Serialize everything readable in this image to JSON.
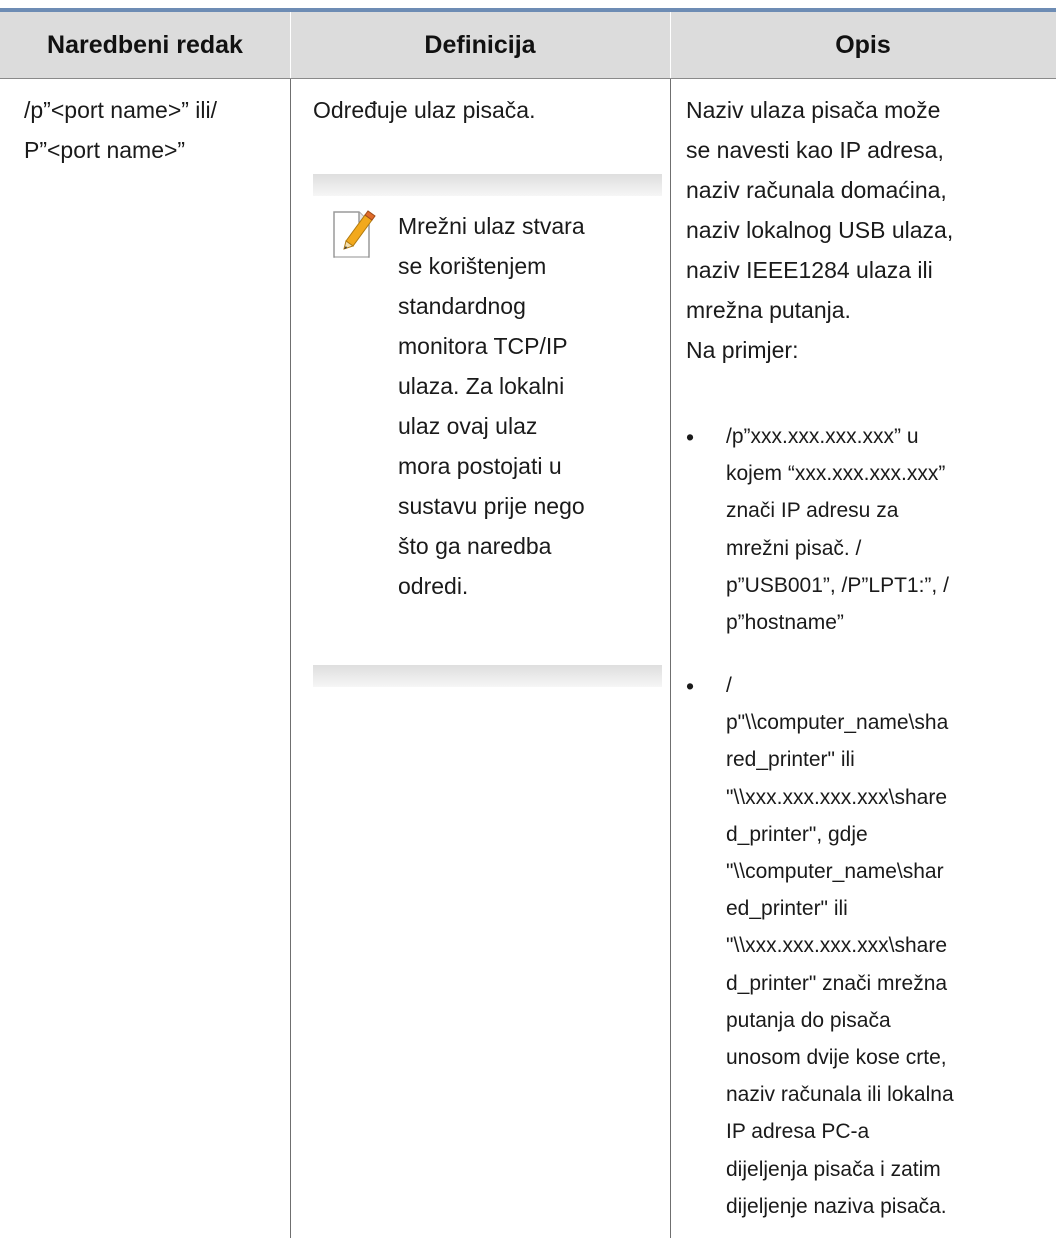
{
  "table": {
    "headers": [
      "Naredbeni redak",
      "Definicija",
      "Opis"
    ],
    "row": {
      "command": "/p”<port name>” ili/\nP”<port name>”",
      "definition": "Određuje ulaz pisača.",
      "note": {
        "icon": "note-pencil-icon",
        "text": "Mrežni ulaz stvara\nse korištenjem\nstandardnog\nmonitora TCP/IP\nulaza. Za lokalni\nulaz ovaj ulaz\nmora postojati u\nsustavu prije nego\nšto ga naredba\nodredi."
      },
      "description": "Naziv ulaza pisača može\nse navesti kao IP adresa,\nnaziv računala domaćina,\nnaziv lokalnog USB ulaza,\nnaziv IEEE1284 ulaza ili\nmrežna putanja.",
      "example_label": "Na primjer:",
      "bullets": [
        "/p”xxx.xxx.xxx.xxx” u\nkojem “xxx.xxx.xxx.xxx”\nznači IP adresu za\nmrežni pisač. /\np”USB001”, /P”LPT1:”, /\np”hostname”",
        "/\np\"\\\\computer_name\\sha\nred_printer\" ili\n\"\\\\xxx.xxx.xxx.xxx\\share\nd_printer\", gdje\n\"\\\\computer_name\\shar\ned_printer\" ili\n\"\\\\xxx.xxx.xxx.xxx\\share\nd_printer\" znači mrežna\nputanja do pisača\nunosom dvije kose crte,\nnaziv računala ili lokalna\nIP adresa PC-a\ndijeljenja pisača i zatim\ndijeljenje naziva pisača."
      ],
      "bullet_symbol": "•"
    }
  },
  "colors": {
    "top_rule": "#6d8cb4",
    "header_bg": "#dcdcdc",
    "grid_line": "#6f6f6f"
  }
}
